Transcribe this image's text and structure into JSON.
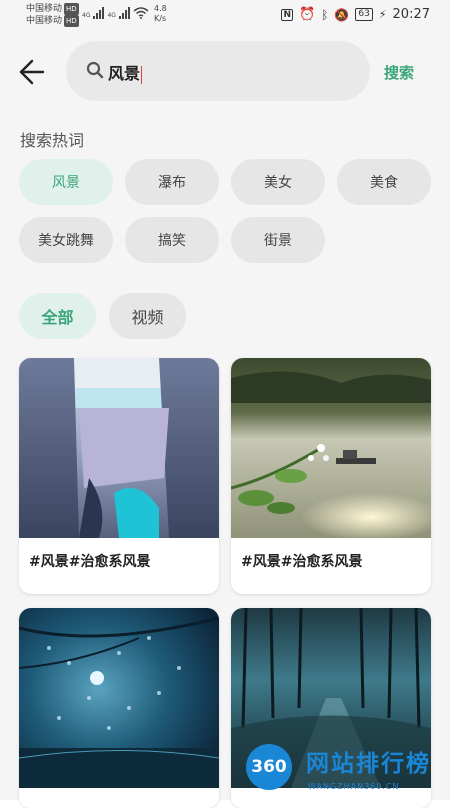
{
  "status_bar": {
    "carrier1": "中国移动",
    "carrier2": "中国移动",
    "hd1": "HD",
    "hd2": "HD",
    "net1": "4G",
    "net2": "4G",
    "speed_value": "4.8",
    "speed_unit": "K/s",
    "battery": "63",
    "time": "20:27"
  },
  "search": {
    "query": "风景",
    "button_label": "搜索"
  },
  "hot_words": {
    "title": "搜索热词",
    "items": [
      "风景",
      "瀑布",
      "美女",
      "美食",
      "美女跳舞",
      "搞笑",
      "街景"
    ]
  },
  "filters": [
    "全部",
    "视频"
  ],
  "results": [
    {
      "title": "#风景#治愈系风景"
    },
    {
      "title": "#风景#治愈系风景"
    },
    {
      "title": ""
    },
    {
      "title": ""
    }
  ],
  "watermark": {
    "number": "360",
    "name": "网站排行榜",
    "sub": "WANGZHAN360.CN"
  },
  "colors": {
    "accent": "#3aa57a",
    "chip_active_bg": "#e0f1ec",
    "page_bg": "#f5f5f5",
    "watermark_blue": "#1a86d6"
  }
}
